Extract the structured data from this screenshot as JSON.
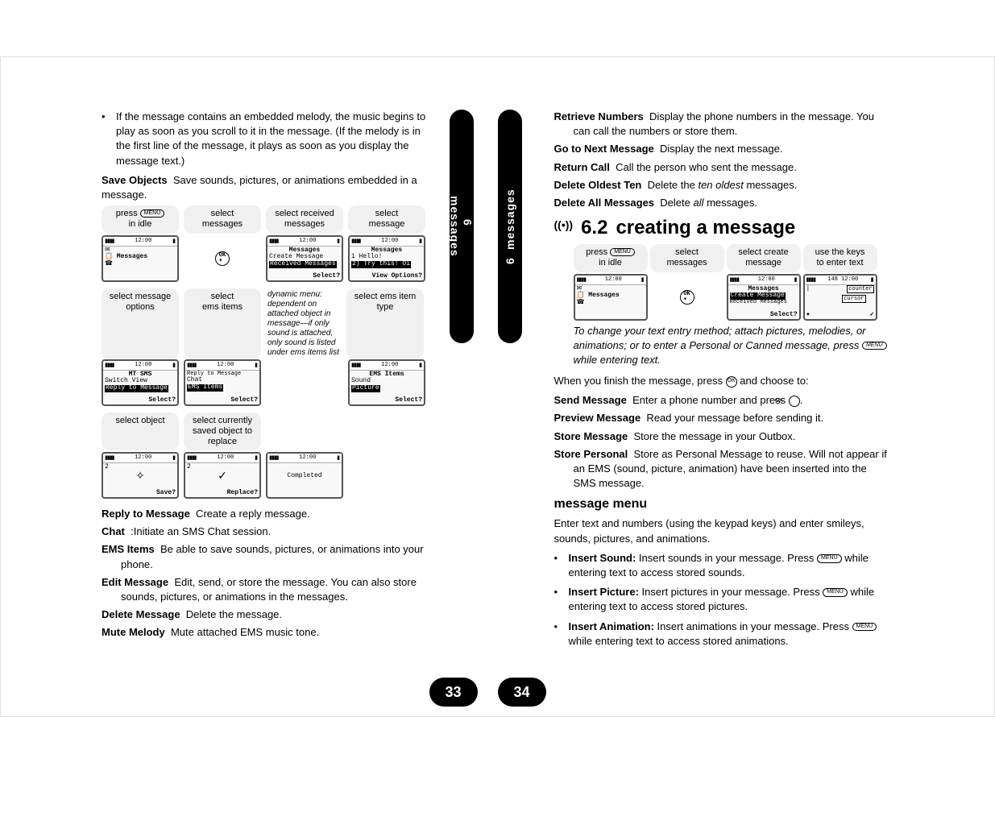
{
  "leftPage": {
    "bullet1": "If the message contains an embedded melody, the music begins to play as soon as you scroll to it in the message. (If the melody is in the first line of the message, it plays as soon as you display the message text.)",
    "saveObjects": {
      "label": "Save Objects",
      "desc": "Save sounds, pictures, or animations embedded in a message."
    },
    "steps1": {
      "headers": [
        "press",
        "in idle",
        "select\nmessages",
        "select received\nmessages",
        "select\nmessage"
      ],
      "pressKey": "MENU",
      "screens": {
        "time": "12:00",
        "messagesLabel": "Messages",
        "createMsg": "Create Message",
        "receivedMsg": "Received Messages",
        "selectFooter": "Select?",
        "tryThis": "2) Try this! Oi",
        "viewOptions": "View Options?",
        "hello": "1 Hello!"
      }
    },
    "steps2": {
      "headers": [
        "select message\noptions",
        "select\nems items",
        "select ems item\ntype"
      ],
      "note": "dynamic menu: dependent on attached object in message—if only sound is attached, only sound is listed under ems items list",
      "screens": {
        "mtSms": "MT SMS",
        "switchView": "Switch View",
        "replyTo": "Reply to Message",
        "chat": "Chat",
        "emsItems": "EMS Items",
        "emsItemsTitle": "EMS Items",
        "sound": "Sound",
        "picture": "Picture",
        "selectFooter": "Select?"
      }
    },
    "steps3": {
      "headers": [
        "select object",
        "select currently\nsaved object to\nreplace",
        ""
      ],
      "screens": {
        "two": "2",
        "save": "Save?",
        "replace": "Replace?",
        "completed": "Completed"
      }
    },
    "defs": [
      {
        "label": "Reply to Message",
        "desc": "Create a reply message."
      },
      {
        "label": "Chat",
        "desc": ":Initiate an SMS Chat session."
      },
      {
        "label": "EMS Items",
        "desc": "Be able to save sounds, pictures, or animations into your phone."
      },
      {
        "label": "Edit Message",
        "desc": "Edit, send, or store the message. You can also store sounds, pictures, or animations in the messages."
      },
      {
        "label": "Delete Message",
        "desc": "Delete the message."
      },
      {
        "label": "Mute Melody",
        "desc": "Mute attached EMS music tone."
      }
    ],
    "sideTab": {
      "num": "6",
      "label": "messages"
    },
    "pageNum": "33"
  },
  "rightPage": {
    "defs1": [
      {
        "label": "Retrieve Numbers",
        "desc": "Display the phone numbers in the message. You can call the numbers or store them."
      },
      {
        "label": "Go to Next Message",
        "desc": "Display the next message."
      },
      {
        "label": "Return Call",
        "desc": "Call the person who sent the message."
      },
      {
        "label": "Delete Oldest Ten",
        "desc": "Delete the ",
        "italic": "ten oldest",
        "desc2": " messages."
      },
      {
        "label": "Delete All Messages",
        "desc": "Delete ",
        "italic": "all",
        "desc2": " messages."
      }
    ],
    "sectionNum": "6.2",
    "sectionTitle": "creating a message",
    "steps": {
      "headers": [
        "press",
        "in idle",
        "select\nmessages",
        "select create\nmessage",
        "use the keys\nto enter text"
      ],
      "pressKey": "MENU",
      "screens": {
        "time": "12:00",
        "messagesLabel": "Messages",
        "createMsg": "Create Message",
        "receivedMsg": "Received Messages",
        "selectFooter": "Select?",
        "count148": "148",
        "counter": "counter",
        "cursor": "cursor"
      }
    },
    "note1a": "To change your text entry method; attach pictures, melodies, or animations; or to enter a Personal or Canned message, press ",
    "note1b": " while entering text.",
    "menuKey": "MENU",
    "finish1": "When you finish the message, press ",
    "okKey": "OK",
    "finish2": " and choose to:",
    "defs2": [
      {
        "label": "Send Message",
        "desc": "Enter a phone number and press ",
        "hasOk": true,
        "desc2": "."
      },
      {
        "label": "Preview Message",
        "desc": "Read your message before sending it."
      },
      {
        "label": "Store Message",
        "desc": "Store the message in your Outbox."
      },
      {
        "label": "Store Personal",
        "desc": "Store as Personal Message to reuse. Will not appear if an EMS (sound, picture, animation) have been inserted into the SMS message."
      }
    ],
    "subheading": "message menu",
    "para1": "Enter text and numbers (using the keypad keys) and enter smileys, sounds, pictures, and animations.",
    "bullets": [
      {
        "label": "Insert Sound:",
        "desc1": " Insert sounds in your message. Press ",
        "desc2": " while entering text to access stored sounds."
      },
      {
        "label": "Insert Picture:",
        "desc1": " Insert pictures in your message. Press ",
        "desc2": " while entering text to access stored pictures."
      },
      {
        "label": "Insert Animation:",
        "desc1": " Insert animations in your message. Press ",
        "desc2": " while entering text to access stored animations."
      }
    ],
    "sideTab": {
      "num": "6",
      "label": "messages"
    },
    "pageNum": "34"
  }
}
